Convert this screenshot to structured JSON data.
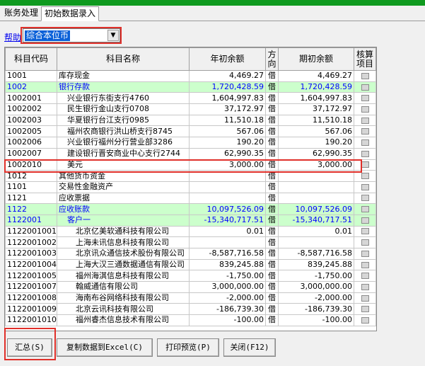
{
  "tabs": [
    {
      "label": "账务处理"
    },
    {
      "label": "初始数据录入"
    }
  ],
  "help_link": "帮助",
  "unit_select": {
    "value": "综合本位币"
  },
  "table": {
    "headers": {
      "code": "科目代码",
      "name": "科目名称",
      "opening": "年初余额",
      "direction": "方向",
      "period": "期初余额",
      "audit": "核算项目"
    },
    "rows": [
      {
        "code": "1001",
        "name": "库存现金",
        "indent": 0,
        "opening": "4,469.27",
        "dir": "借",
        "period": "4,469.27",
        "green": false
      },
      {
        "code": "1002",
        "name": "银行存款",
        "indent": 0,
        "opening": "1,720,428.59",
        "dir": "借",
        "period": "1,720,428.59",
        "green": true
      },
      {
        "code": "1002001",
        "name": "兴业银行东街支行4760",
        "indent": 1,
        "opening": "1,604,997.83",
        "dir": "借",
        "period": "1,604,997.83",
        "green": false
      },
      {
        "code": "1002002",
        "name": "民生银行金山支行0708",
        "indent": 1,
        "opening": "37,172.97",
        "dir": "借",
        "period": "37,172.97",
        "green": false
      },
      {
        "code": "1002003",
        "name": "华夏银行台江支行0985",
        "indent": 1,
        "opening": "11,510.18",
        "dir": "借",
        "period": "11,510.18",
        "green": false
      },
      {
        "code": "1002005",
        "name": "福州农商银行洪山桥支行8745",
        "indent": 1,
        "opening": "567.06",
        "dir": "借",
        "period": "567.06",
        "green": false
      },
      {
        "code": "1002006",
        "name": "兴业银行福州分行营业部3286",
        "indent": 1,
        "opening": "190.20",
        "dir": "借",
        "period": "190.20",
        "green": false
      },
      {
        "code": "1002007",
        "name": "建设银行晋安商业中心支行2744",
        "indent": 1,
        "opening": "62,990.35",
        "dir": "借",
        "period": "62,990.35",
        "green": false
      },
      {
        "code": "1002010",
        "name": "美元",
        "indent": 1,
        "opening": "3,000.00",
        "dir": "借",
        "period": "3,000.00",
        "green": false
      },
      {
        "code": "1012",
        "name": "其他货币资金",
        "indent": 0,
        "opening": "",
        "dir": "借",
        "period": "",
        "green": false
      },
      {
        "code": "1101",
        "name": "交易性金融资产",
        "indent": 0,
        "opening": "",
        "dir": "借",
        "period": "",
        "green": false
      },
      {
        "code": "1121",
        "name": "应收票据",
        "indent": 0,
        "opening": "",
        "dir": "借",
        "period": "",
        "green": false
      },
      {
        "code": "1122",
        "name": "应收账款",
        "indent": 0,
        "opening": "10,097,526.09",
        "dir": "借",
        "period": "10,097,526.09",
        "green": true
      },
      {
        "code": "1122001",
        "name": "客户一",
        "indent": 1,
        "opening": "-15,340,717.51",
        "dir": "借",
        "period": "-15,340,717.51",
        "green": true
      },
      {
        "code": "1122001001",
        "name": "北京亿美软通科技有限公司",
        "indent": 2,
        "opening": "0.01",
        "dir": "借",
        "period": "0.01",
        "green": false
      },
      {
        "code": "1122001002",
        "name": "上海未讯信息科技有限公司",
        "indent": 2,
        "opening": "",
        "dir": "借",
        "period": "",
        "green": false
      },
      {
        "code": "1122001003",
        "name": "北京讯众通信技术股份有限公司",
        "indent": 2,
        "opening": "-8,587,716.58",
        "dir": "借",
        "period": "-8,587,716.58",
        "green": false
      },
      {
        "code": "1122001004",
        "name": "上海大汉三通数据通信有限公司",
        "indent": 2,
        "opening": "839,245.88",
        "dir": "借",
        "period": "839,245.88",
        "green": false
      },
      {
        "code": "1122001005",
        "name": "福州海淇信息科技有限公司",
        "indent": 2,
        "opening": "-1,750.00",
        "dir": "借",
        "period": "-1,750.00",
        "green": false
      },
      {
        "code": "1122001007",
        "name": "翰威通信有限公司",
        "indent": 2,
        "opening": "3,000,000.00",
        "dir": "借",
        "period": "3,000,000.00",
        "green": false
      },
      {
        "code": "1122001008",
        "name": "海南布谷网络科技有限公司",
        "indent": 2,
        "opening": "-2,000.00",
        "dir": "借",
        "period": "-2,000.00",
        "green": false
      },
      {
        "code": "1122001009",
        "name": "北京云讯科技有限公司",
        "indent": 2,
        "opening": "-186,739.30",
        "dir": "借",
        "period": "-186,739.30",
        "green": false
      },
      {
        "code": "1122001010",
        "name": "福州睿杰信息技术有限公司",
        "indent": 2,
        "opening": "-100.00",
        "dir": "借",
        "period": "-100.00",
        "green": false
      }
    ]
  },
  "buttons": {
    "summary": "汇总(S)",
    "copy_excel": "复制数据到Excel(C)",
    "print_preview": "打印预览(P)",
    "close": "关闭(F12)"
  },
  "colors": {
    "accent_green": "#0f9a1f",
    "row_highlight": "#ccffcc",
    "highlight_box": "#e0302a"
  }
}
